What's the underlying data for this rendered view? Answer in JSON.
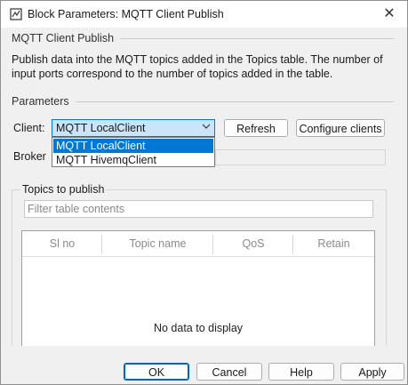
{
  "window": {
    "title": "Block Parameters: MQTT Client Publish"
  },
  "block": {
    "name": "MQTT Client Publish",
    "description": "Publish data into the MQTT topics added in the Topics table. The number of input ports correspond to the number of topics added in the table."
  },
  "parameters": {
    "heading": "Parameters",
    "client_label": "Client:",
    "client_value": "MQTT LocalClient",
    "client_options": [
      "MQTT LocalClient",
      "MQTT HivemqClient"
    ],
    "refresh_label": "Refresh",
    "configure_label": "Configure clients",
    "broker_label": "Broker"
  },
  "topics": {
    "heading": "Topics to publish",
    "filter_placeholder": "Filter table contents",
    "columns": [
      "Sl no",
      "Topic name",
      "QoS",
      "Retain"
    ],
    "empty_message": "No data to display"
  },
  "buttons": {
    "ok": "OK",
    "cancel": "Cancel",
    "help": "Help",
    "apply": "Apply"
  }
}
